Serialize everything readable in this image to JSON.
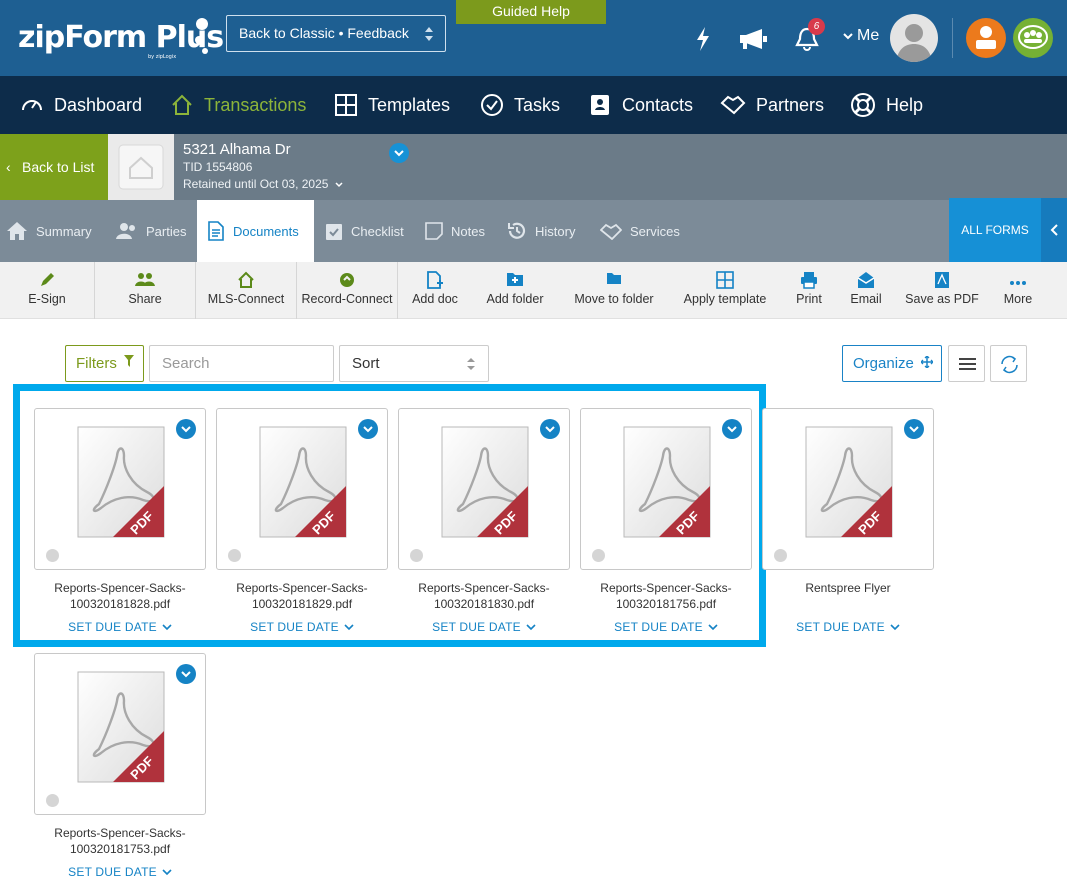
{
  "header": {
    "logo": "zipForm Plus",
    "logo_sub": "by zipLogix",
    "classic_label": "Back to Classic • Feedback",
    "guided_help": "Guided Help",
    "notification_count": "6",
    "me_label": "Me"
  },
  "nav": {
    "items": [
      {
        "label": "Dashboard",
        "icon": "gauge-icon"
      },
      {
        "label": "Transactions",
        "icon": "house-icon"
      },
      {
        "label": "Templates",
        "icon": "grid-icon"
      },
      {
        "label": "Tasks",
        "icon": "check-circle-icon"
      },
      {
        "label": "Contacts",
        "icon": "address-book-icon"
      },
      {
        "label": "Partners",
        "icon": "handshake-icon"
      },
      {
        "label": "Help",
        "icon": "lifebuoy-icon"
      }
    ],
    "active": "Transactions"
  },
  "transaction": {
    "back_label": "Back to List",
    "address": "5321 Alhama Dr",
    "tid": "TID 1554806",
    "retained": "Retained until Oct 03, 2025"
  },
  "tabs": {
    "items": [
      "Summary",
      "Parties",
      "Documents",
      "Checklist",
      "Notes",
      "History",
      "Services"
    ],
    "active": "Documents",
    "all_forms": "ALL FORMS"
  },
  "toolbar": {
    "items": [
      "E-Sign",
      "Share",
      "MLS-Connect",
      "Record-Connect",
      "Add doc",
      "Add folder",
      "Move to folder",
      "Apply template",
      "Print",
      "Email",
      "Save as PDF",
      "More"
    ]
  },
  "controls": {
    "filters_label": "Filters",
    "search_placeholder": "Search",
    "sort_label": "Sort",
    "organize_label": "Organize"
  },
  "documents": [
    {
      "name_line1": "Reports-Spencer-Sacks-",
      "name_line2": "100320181828.pdf",
      "due_label": "SET DUE DATE"
    },
    {
      "name_line1": "Reports-Spencer-Sacks-",
      "name_line2": "100320181829.pdf",
      "due_label": "SET DUE DATE"
    },
    {
      "name_line1": "Reports-Spencer-Sacks-",
      "name_line2": "100320181830.pdf",
      "due_label": "SET DUE DATE"
    },
    {
      "name_line1": "Reports-Spencer-Sacks-",
      "name_line2": "100320181756.pdf",
      "due_label": "SET DUE DATE"
    },
    {
      "name_line1": "Rentspree Flyer",
      "name_line2": "",
      "due_label": "SET DUE DATE"
    },
    {
      "name_line1": "Reports-Spencer-Sacks-",
      "name_line2": "100320181753.pdf",
      "due_label": "SET DUE DATE"
    }
  ],
  "pdf_badge": "PDF",
  "colors": {
    "header_blue": "#1e5f92",
    "nav_dark": "#0d2c4a",
    "accent_green": "#7da11b",
    "accent_blue": "#1583c5",
    "highlight": "#00a9ec"
  }
}
